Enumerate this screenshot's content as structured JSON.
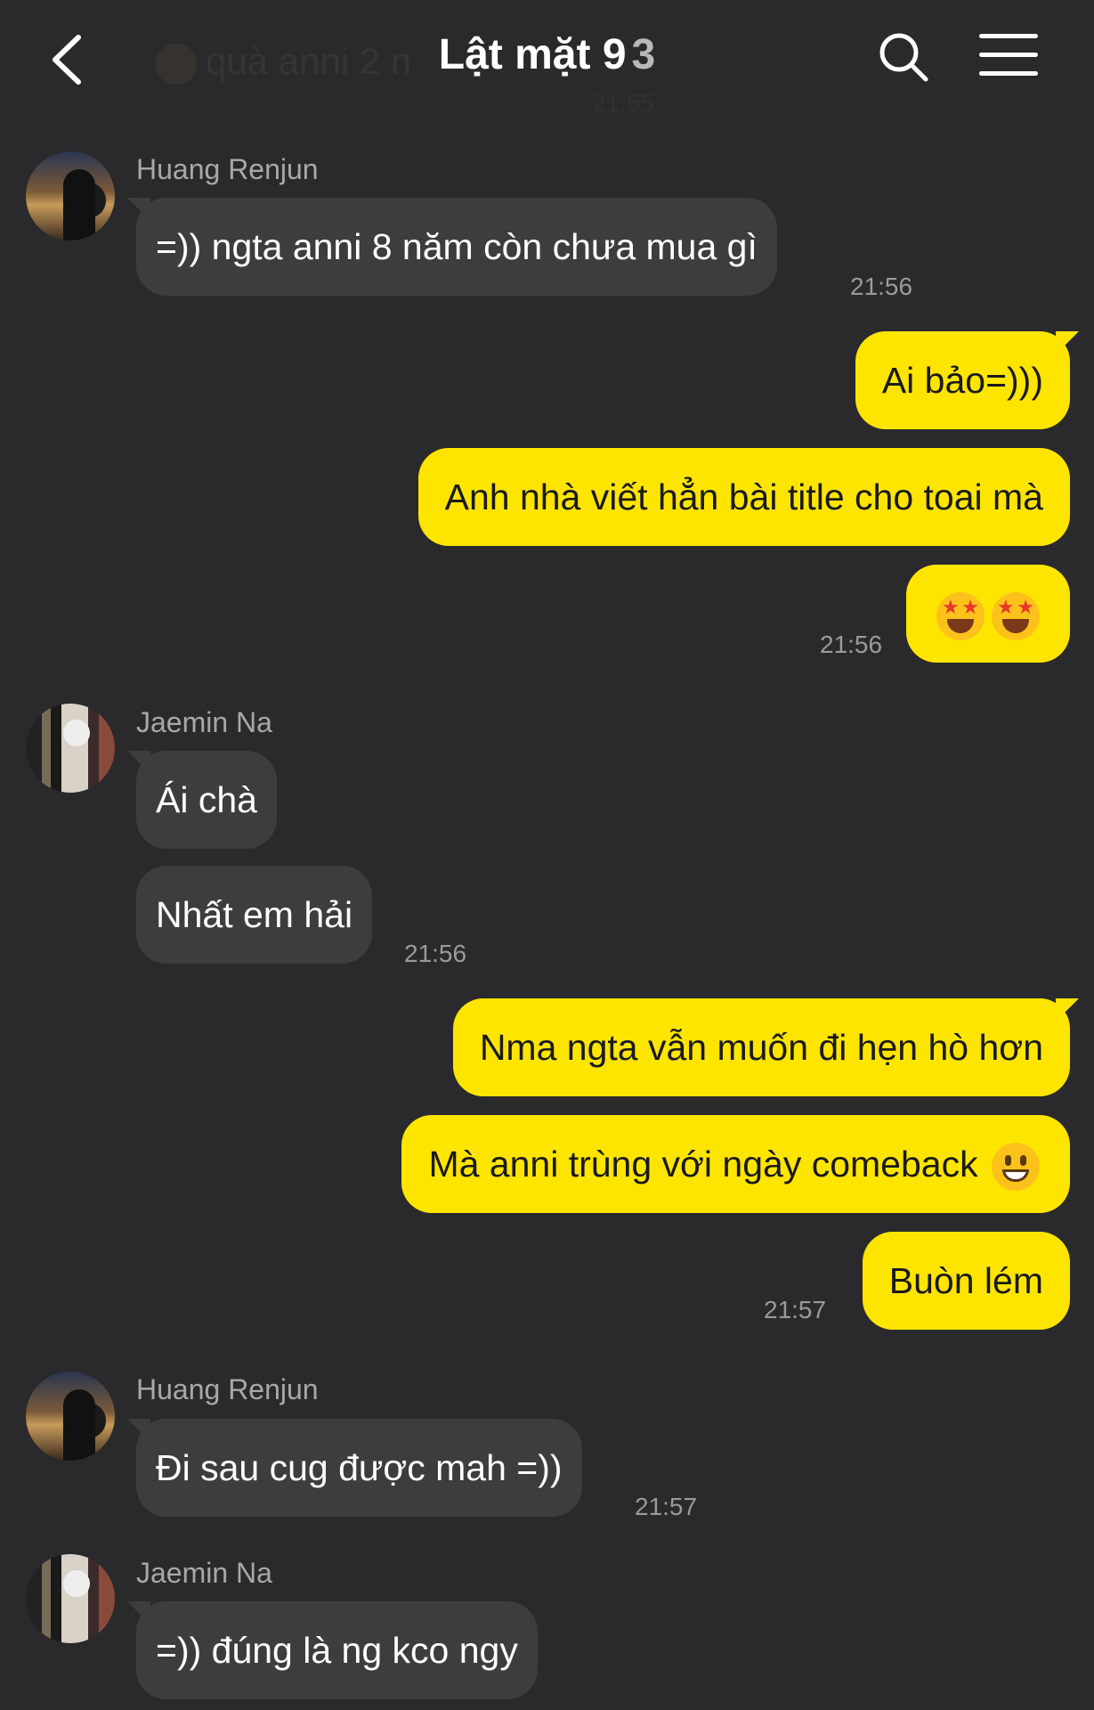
{
  "header": {
    "title": "Lật mặt 9",
    "member_count": "3",
    "ghost_message": "quà anni 2 n",
    "ghost_time": "21:55"
  },
  "messages": [
    {
      "sender": "Huang Renjun",
      "text": "=)) ngta anni 8 năm còn chưa mua gì",
      "time": "21:56"
    },
    {
      "text": "Ai bảo=)))"
    },
    {
      "text": "Anh nhà viết hẳn bài title cho toai mà"
    },
    {
      "emoji": [
        "star-struck-emoji",
        "star-struck-emoji"
      ],
      "time": "21:56"
    },
    {
      "sender": "Jaemin Na",
      "text": "Ái chà"
    },
    {
      "text": "Nhất em hải",
      "time": "21:56"
    },
    {
      "text": "Nma ngta vẫn muốn đi hẹn hò hơn"
    },
    {
      "text": "Mà anni trùng với ngày comeback",
      "emoji": "grinning-emoji"
    },
    {
      "text": "Buòn lém",
      "time": "21:57"
    },
    {
      "sender": "Huang Renjun",
      "text": "Đi sau cug được mah =))",
      "time": "21:57"
    },
    {
      "sender": "Jaemin Na",
      "text": "=)) đúng là ng kco ngy"
    }
  ],
  "colors": {
    "background": "#2a2a2c",
    "incoming": "#3d3d40",
    "outgoing": "#fee500"
  }
}
